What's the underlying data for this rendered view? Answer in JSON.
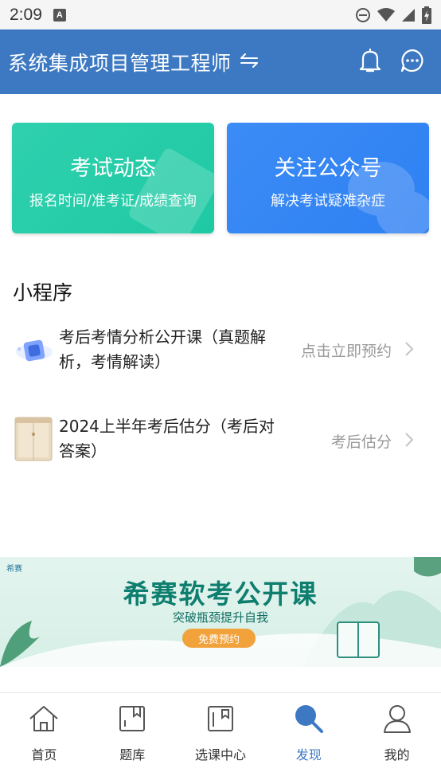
{
  "status_bar": {
    "time": "2:09",
    "notification_icon": "A"
  },
  "app_bar": {
    "title": "系统集成项目管理工程师",
    "switch_icon": "switch-arrows-icon",
    "bell_icon": "bell-icon",
    "message_icon": "chat-bubble-icon"
  },
  "cards": [
    {
      "title": "考试动态",
      "subtitle": "报名时间/准考证/成绩查询",
      "color": "#22cca6"
    },
    {
      "title": "关注公众号",
      "subtitle": "解决考试疑难杂症",
      "color": "#3385f4"
    }
  ],
  "mini_programs": {
    "title": "小程序",
    "items": [
      {
        "text": "考后考情分析公开课（真题解析，考情解读）",
        "action": "点击立即预约",
        "icon": "video-cube-icon"
      },
      {
        "text": "2024上半年考后估分（考后对答案）",
        "action": "考后估分",
        "icon": "envelope-folder-icon"
      }
    ]
  },
  "banner": {
    "brand": "希赛",
    "title": "希赛软考公开课",
    "subtitle": "突破瓶颈提升自我",
    "button": "免费预约"
  },
  "bottom_nav": {
    "active": "发现",
    "items": [
      {
        "label": "首页",
        "icon": "home-icon"
      },
      {
        "label": "题库",
        "icon": "question-bank-icon"
      },
      {
        "label": "选课中心",
        "icon": "course-center-icon"
      },
      {
        "label": "发现",
        "icon": "discover-search-icon"
      },
      {
        "label": "我的",
        "icon": "profile-icon"
      }
    ]
  },
  "colors": {
    "primary": "#3d79c2",
    "card_green": "#22cca6",
    "card_blue": "#3385f4",
    "banner_accent": "#f2a23b"
  }
}
